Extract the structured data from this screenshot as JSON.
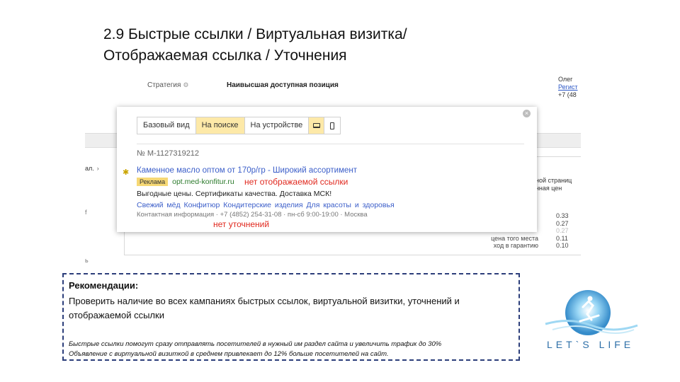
{
  "slide": {
    "title_line1": "2.9 Быстрые ссылки / Виртуальная визитка/",
    "title_line2": "Отображаемая ссылка / Уточнения"
  },
  "background": {
    "strategy_label": "Стратегия",
    "position_label": "Наивысшая доступная позиция",
    "right_col": [
      "Олег",
      "Регист",
      "+7 (48"
    ],
    "left_tab": "ал.",
    "head_right": [
      "розной страниц",
      "есечная цен"
    ],
    "rows": [
      {
        "label": "",
        "value": "0.33",
        "faded": false
      },
      {
        "label": "",
        "value": "0.27",
        "faded": false
      },
      {
        "label": "",
        "value": "0.27",
        "faded": true
      },
      {
        "label": "цена  того места",
        "value": "0.11",
        "faded": false
      },
      {
        "label": "ход в гарантию",
        "value": "0.10",
        "faded": false
      }
    ],
    "left_mark1": "f",
    "left_mark2": "ь"
  },
  "popup": {
    "tabs": [
      {
        "label": "Базовый вид",
        "active": false
      },
      {
        "label": "На поиске",
        "active": true
      },
      {
        "label": "На устройстве",
        "active": false
      }
    ],
    "device_icons": [
      {
        "name": "laptop-icon",
        "active": true
      },
      {
        "name": "phone-icon",
        "active": false
      }
    ],
    "ad_number": "№ М-1127319212",
    "ad_title": "Каменное масло оптом от 170р/гр - Широкий ассортимент",
    "ad_label": "Реклама",
    "ad_url": "opt.med-konfitur.ru",
    "ad_desc": "Выгодные цены. Сертификаты качества. Доставка МСК!",
    "ad_links": [
      "Свежий мёд",
      "Конфитюр",
      "Кондитерские изделия",
      "Для красоты и здоровья"
    ],
    "ad_contact": "Контактная информация · +7 (4852) 254-31-08 · пн-сб 9:00-19:00 · Москва"
  },
  "annotations": {
    "no_display_link": "нет отображаемой ссылки",
    "no_callouts": "нет уточнений"
  },
  "recommendations": {
    "title": "Рекомендации:",
    "text": "Проверить наличие во всех кампаниях быстрых ссылок, виртуальной визитки, уточнений и отображаемой ссылки",
    "note_line1": "Быстрые ссылки помогут сразу отправлять посетителей в нужный им раздел сайта и увеличить трафик до 30%",
    "note_line2": "Объявление с виртуальной визиткой в среднем привлекает до 12% больше посетителей на сайт."
  },
  "logo": {
    "text": "LET`S LIFE"
  }
}
